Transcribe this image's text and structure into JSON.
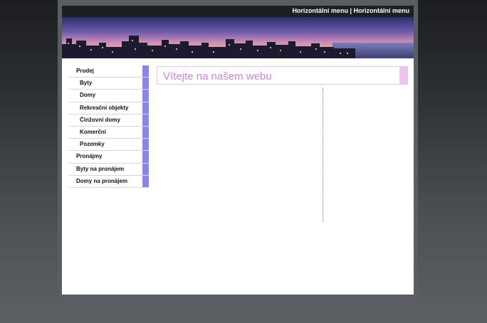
{
  "header": {
    "nav_links": [
      "Horizontální menu",
      "Horizontální menu"
    ],
    "separator": "|"
  },
  "sidebar": {
    "items": [
      {
        "label": "Prodej",
        "level": "top"
      },
      {
        "label": "Byty",
        "level": "sub"
      },
      {
        "label": "Domy",
        "level": "sub"
      },
      {
        "label": "Rekreační objekty",
        "level": "sub"
      },
      {
        "label": "Činžovní domy",
        "level": "sub"
      },
      {
        "label": "Komerční",
        "level": "sub"
      },
      {
        "label": "Pozemky",
        "level": "sub"
      },
      {
        "label": "Pronájmy",
        "level": "top"
      },
      {
        "label": "Byty na pronájem",
        "level": "top"
      },
      {
        "label": "Domy na pronájem",
        "level": "top"
      }
    ]
  },
  "main": {
    "welcome_title": "Vítejte na našem webu"
  },
  "colors": {
    "menu_stripe": "#8b86e0",
    "title_accent": "#c987d2",
    "title_box_accent": "#ecc4f0",
    "topbar": "#1e1f21"
  }
}
